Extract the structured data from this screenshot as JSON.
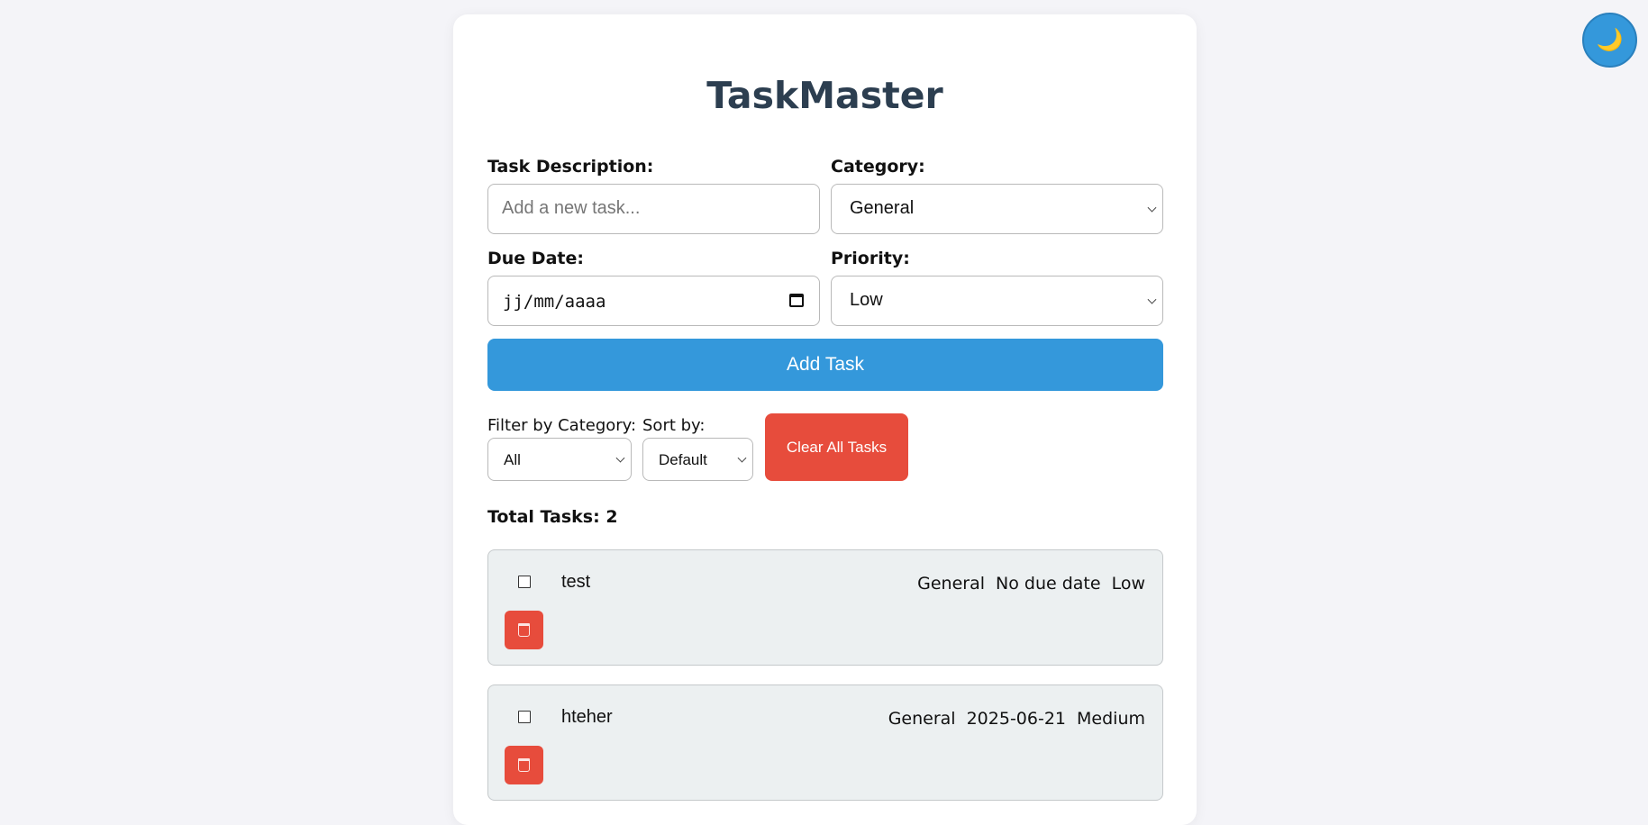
{
  "app": {
    "title": "TaskMaster",
    "theme_toggle_icon": "moon-icon",
    "theme_toggle_glyph": "🌙"
  },
  "form": {
    "description_label": "Task Description:",
    "description_placeholder": "Add a new task...",
    "category_label": "Category:",
    "category_value": "General",
    "due_label": "Due Date:",
    "due_placeholder": "jj/mm/aaaa",
    "priority_label": "Priority:",
    "priority_value": "Low",
    "add_button": "Add Task"
  },
  "controls": {
    "filter_label": "Filter by Category:",
    "filter_value": "All",
    "sort_label": "Sort by:",
    "sort_value": "Default",
    "clear_button": "Clear All Tasks"
  },
  "summary": {
    "total": "Total Tasks: 2"
  },
  "tasks": [
    {
      "text": "test",
      "category": "General",
      "due": "No due date",
      "priority": "Low",
      "completed": false
    },
    {
      "text": "hteher",
      "category": "General",
      "due": "2025-06-21",
      "priority": "Medium",
      "completed": false
    }
  ],
  "colors": {
    "accent": "#3498db",
    "danger": "#e74c3c",
    "title": "#2c3e50",
    "task_bg": "#ecf0f1",
    "page_bg": "#f4f4f8"
  }
}
